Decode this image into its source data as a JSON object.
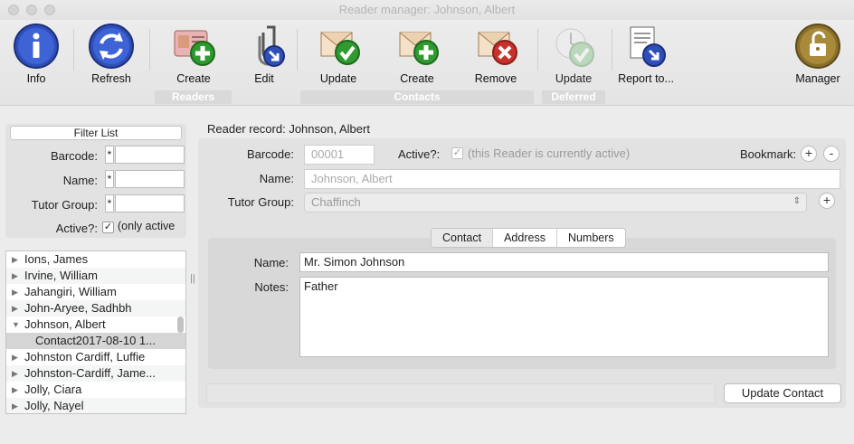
{
  "window": {
    "title": "Reader manager: Johnson, Albert"
  },
  "toolbar": {
    "info": "Info",
    "refresh": "Refresh",
    "create_reader": "Create",
    "edit": "Edit",
    "update_contact": "Update",
    "create_contact": "Create",
    "remove_contact": "Remove",
    "update_deferred": "Update",
    "report": "Report to...",
    "manager": "Manager",
    "groups": {
      "readers": "Readers",
      "contacts": "Contacts",
      "deferred": "Deferred"
    }
  },
  "filter": {
    "title": "Filter List",
    "barcode_label": "Barcode:",
    "name_label": "Name:",
    "tutor_label": "Tutor Group:",
    "active_label": "Active?:",
    "active_note": "(only active",
    "star": "*"
  },
  "list": {
    "items": [
      {
        "label": "Ions,  James",
        "disc": "▶"
      },
      {
        "label": "Irvine,  William",
        "disc": "▶"
      },
      {
        "label": "Jahangiri,  William",
        "disc": "▶"
      },
      {
        "label": "John-Aryee,  Sadhbh",
        "disc": "▶"
      },
      {
        "label": "Johnson, Albert",
        "disc": "▼"
      },
      {
        "label": "Contact2017-08-10 1...",
        "disc": ""
      },
      {
        "label": "Johnston Cardiff,  Luffie",
        "disc": "▶"
      },
      {
        "label": "Johnston-Cardiff,  Jame...",
        "disc": "▶"
      },
      {
        "label": "Jolly,  Ciara",
        "disc": "▶"
      },
      {
        "label": "Jolly,  Nayel",
        "disc": "▶"
      }
    ]
  },
  "record": {
    "title": "Reader record: Johnson, Albert",
    "barcode_label": "Barcode:",
    "barcode_value": "00001",
    "active_label": "Active?:",
    "active_note": "(this Reader is currently active)",
    "bookmark_label": "Bookmark:",
    "name_label": "Name:",
    "name_value": "Johnson, Albert",
    "tutor_label": "Tutor Group:",
    "tutor_value": "Chaffinch"
  },
  "contact": {
    "tabs": [
      "Contact",
      "Address",
      "Numbers"
    ],
    "name_label": "Name:",
    "name_value": "Mr. Simon Johnson",
    "notes_label": "Notes:",
    "notes_value": "Father",
    "update_button": "Update Contact"
  }
}
